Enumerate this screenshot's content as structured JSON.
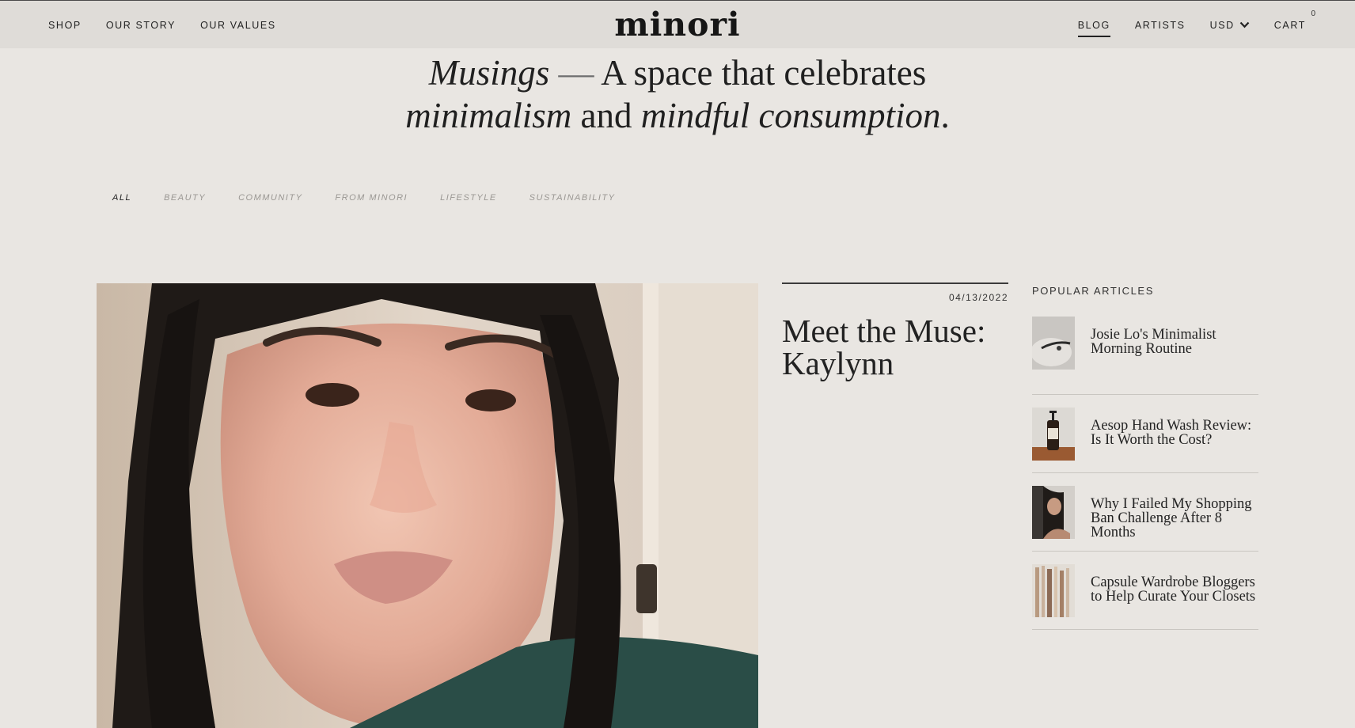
{
  "header": {
    "logo": "minori",
    "nav_left": [
      "SHOP",
      "OUR STORY",
      "OUR VALUES"
    ],
    "nav_right": {
      "blog": "BLOG",
      "artists": "ARTISTS",
      "currency": "USD",
      "cart": "CART",
      "cart_count": "0"
    }
  },
  "hero": {
    "part1_italic": "Musings",
    "dash": " — ",
    "part2": "A space that celebrates",
    "part3_italic": "minimalism",
    "part4": " and ",
    "part5_italic": "mindful consumption",
    "part6": "."
  },
  "filters": [
    "ALL",
    "BEAUTY",
    "COMMUNITY",
    "FROM MINORI",
    "LIFESTYLE",
    "SUSTAINABILITY"
  ],
  "active_filter": "ALL",
  "featured": {
    "date": "04/13/2022",
    "title_line1": "Meet the Muse:",
    "title_line2": "Kaylynn"
  },
  "popular": {
    "heading": "POPULAR ARTICLES",
    "items": [
      {
        "title": "Josie Lo's Minimalist Morning Routine"
      },
      {
        "title": "Aesop Hand Wash Review: Is It Worth the Cost?"
      },
      {
        "title": "Why I Failed My Shopping Ban Challenge After 8 Months"
      },
      {
        "title": "Capsule Wardrobe Bloggers to Help Curate Your Closets"
      }
    ]
  },
  "colors": {
    "background": "#e9e6e2",
    "header_bg": "#dfdcd8",
    "text": "#1e1e1e",
    "filter_inactive": "#9a9793"
  }
}
